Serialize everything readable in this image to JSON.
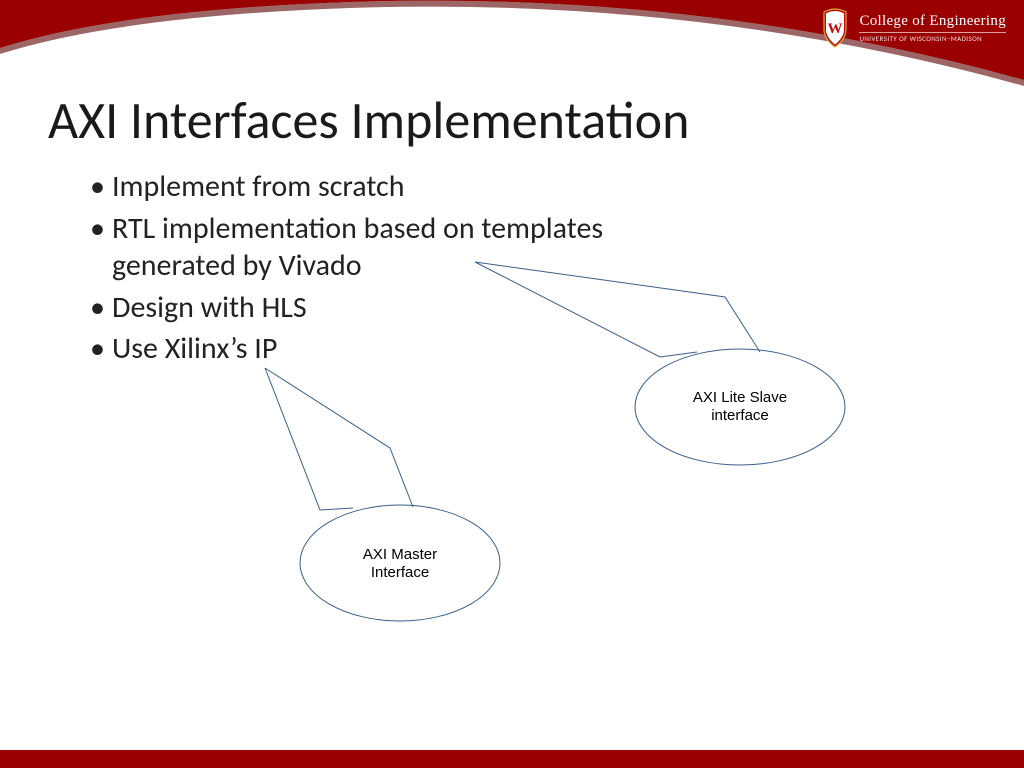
{
  "header": {
    "college": "College of Engineering",
    "university": "UNIVERSITY OF WISCONSIN–MADISON",
    "crest_letter": "W"
  },
  "title": "AXI Interfaces Implementation",
  "bullets": [
    "Implement from scratch",
    "RTL implementation based on templates generated by Vivado",
    "Design with HLS",
    "Use Xilinx’s IP"
  ],
  "callouts": {
    "right": "AXI Lite Slave interface",
    "left": "AXI Master Interface"
  },
  "colors": {
    "brand_red": "#9b0000",
    "callout_stroke": "#3a5f8a"
  }
}
